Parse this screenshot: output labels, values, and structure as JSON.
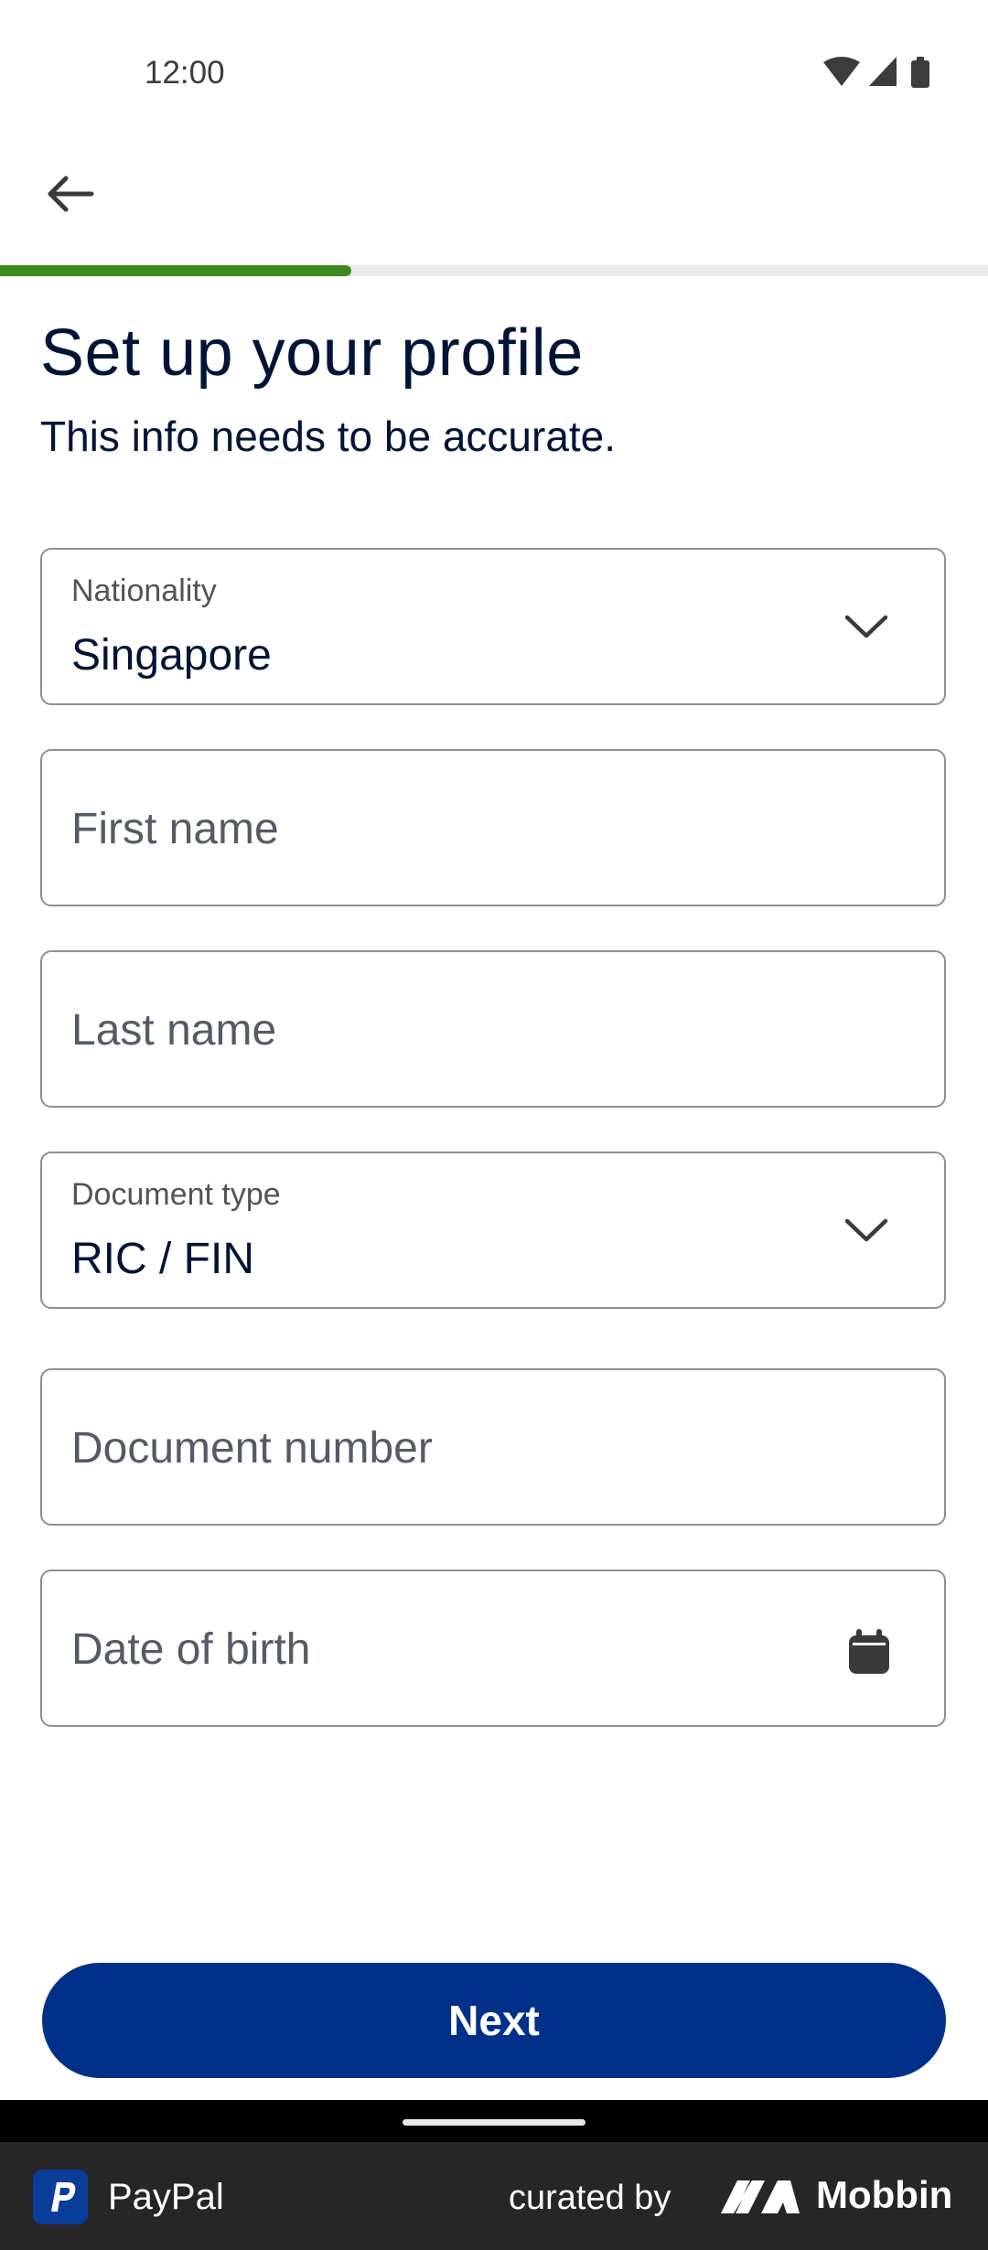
{
  "status_bar": {
    "time": "12:00"
  },
  "progress": {
    "fraction": 0.356,
    "color": "#3f8a1e"
  },
  "header": {
    "title": "Set up your profile",
    "subtitle": "This info needs to be accurate."
  },
  "form": {
    "nationality": {
      "label": "Nationality",
      "value": "Singapore"
    },
    "first_name": {
      "placeholder": "First name"
    },
    "last_name": {
      "placeholder": "Last name"
    },
    "document_type": {
      "label": "Document type",
      "value": "RIC / FIN"
    },
    "document_number": {
      "placeholder": "Document number"
    },
    "date_of_birth": {
      "placeholder": "Date of birth"
    }
  },
  "actions": {
    "next_label": "Next",
    "button_color": "#003087"
  },
  "footer": {
    "app_name": "PayPal",
    "curated_by": "curated by",
    "brand": "Mobbin"
  }
}
